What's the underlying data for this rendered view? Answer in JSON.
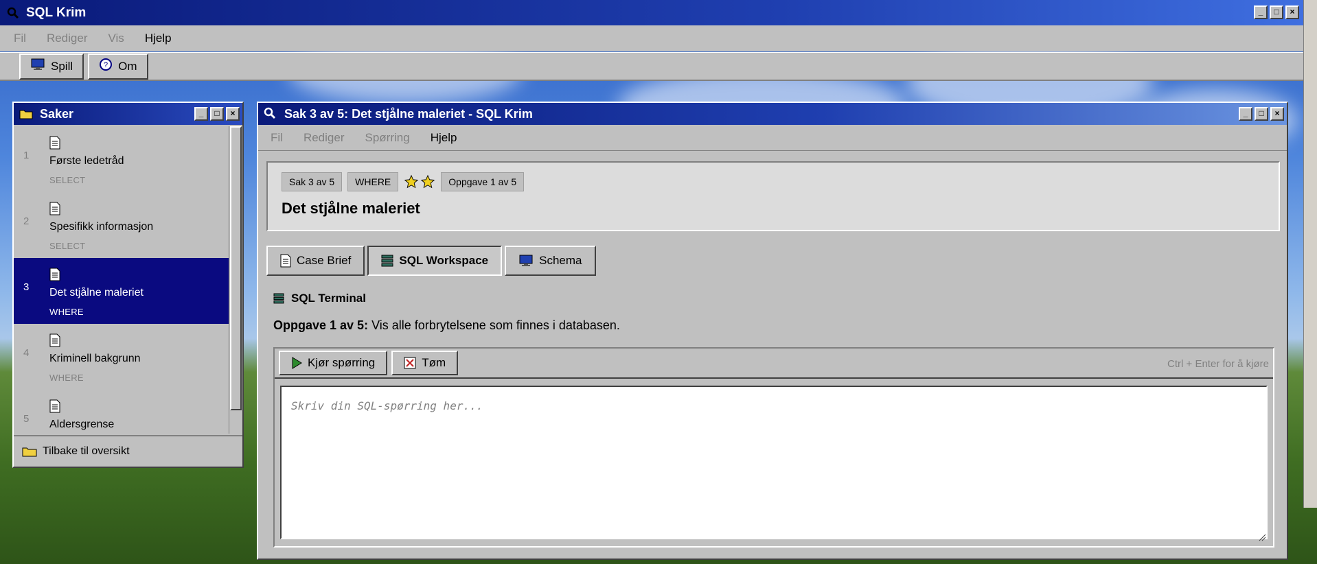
{
  "app": {
    "title": "SQL Krim",
    "menu": [
      "Fil",
      "Rediger",
      "Vis",
      "Hjelp"
    ],
    "toolbar": {
      "play_label": "Spill",
      "about_label": "Om"
    }
  },
  "sidebar": {
    "title": "Saker",
    "items": [
      {
        "num": "1",
        "label": "Første ledetråd",
        "tag": "SELECT"
      },
      {
        "num": "2",
        "label": "Spesifikk informasjon",
        "tag": "SELECT"
      },
      {
        "num": "3",
        "label": "Det stjålne maleriet",
        "tag": "WHERE"
      },
      {
        "num": "4",
        "label": "Kriminell bakgrunn",
        "tag": "WHERE"
      },
      {
        "num": "5",
        "label": "Aldersgrense",
        "tag": ""
      }
    ],
    "active_index": 2,
    "footer_label": "Tilbake til oversikt"
  },
  "case_window": {
    "title": "Sak 3 av 5: Det stjålne maleriet - SQL Krim",
    "menu": [
      "Fil",
      "Rediger",
      "Spørring",
      "Hjelp"
    ],
    "badges": {
      "case": "Sak 3 av 5",
      "topic": "WHERE",
      "task": "Oppgave 1 av 5"
    },
    "difficulty_stars": 2,
    "heading": "Det stjålne maleriet",
    "tabs": {
      "brief": "Case Brief",
      "workspace": "SQL Workspace",
      "schema": "Schema"
    },
    "active_tab": "workspace",
    "terminal_title": "SQL Terminal",
    "task_prefix": "Oppgave 1 av 5:",
    "task_text": " Vis alle forbrytelsene som finnes i databasen.",
    "run_label": "Kjør spørring",
    "clear_label": "Tøm",
    "hint": "Ctrl + Enter for å kjøre",
    "editor_placeholder": "Skriv din SQL-spørring her...",
    "editor_value": ""
  },
  "colors": {
    "titlebar": "#0a1a7a",
    "selection": "#0a0a80",
    "face": "#c0c0c0",
    "run_icon": "#2e8b2e",
    "clear_icon": "#c02020",
    "star": "#f0d020"
  }
}
